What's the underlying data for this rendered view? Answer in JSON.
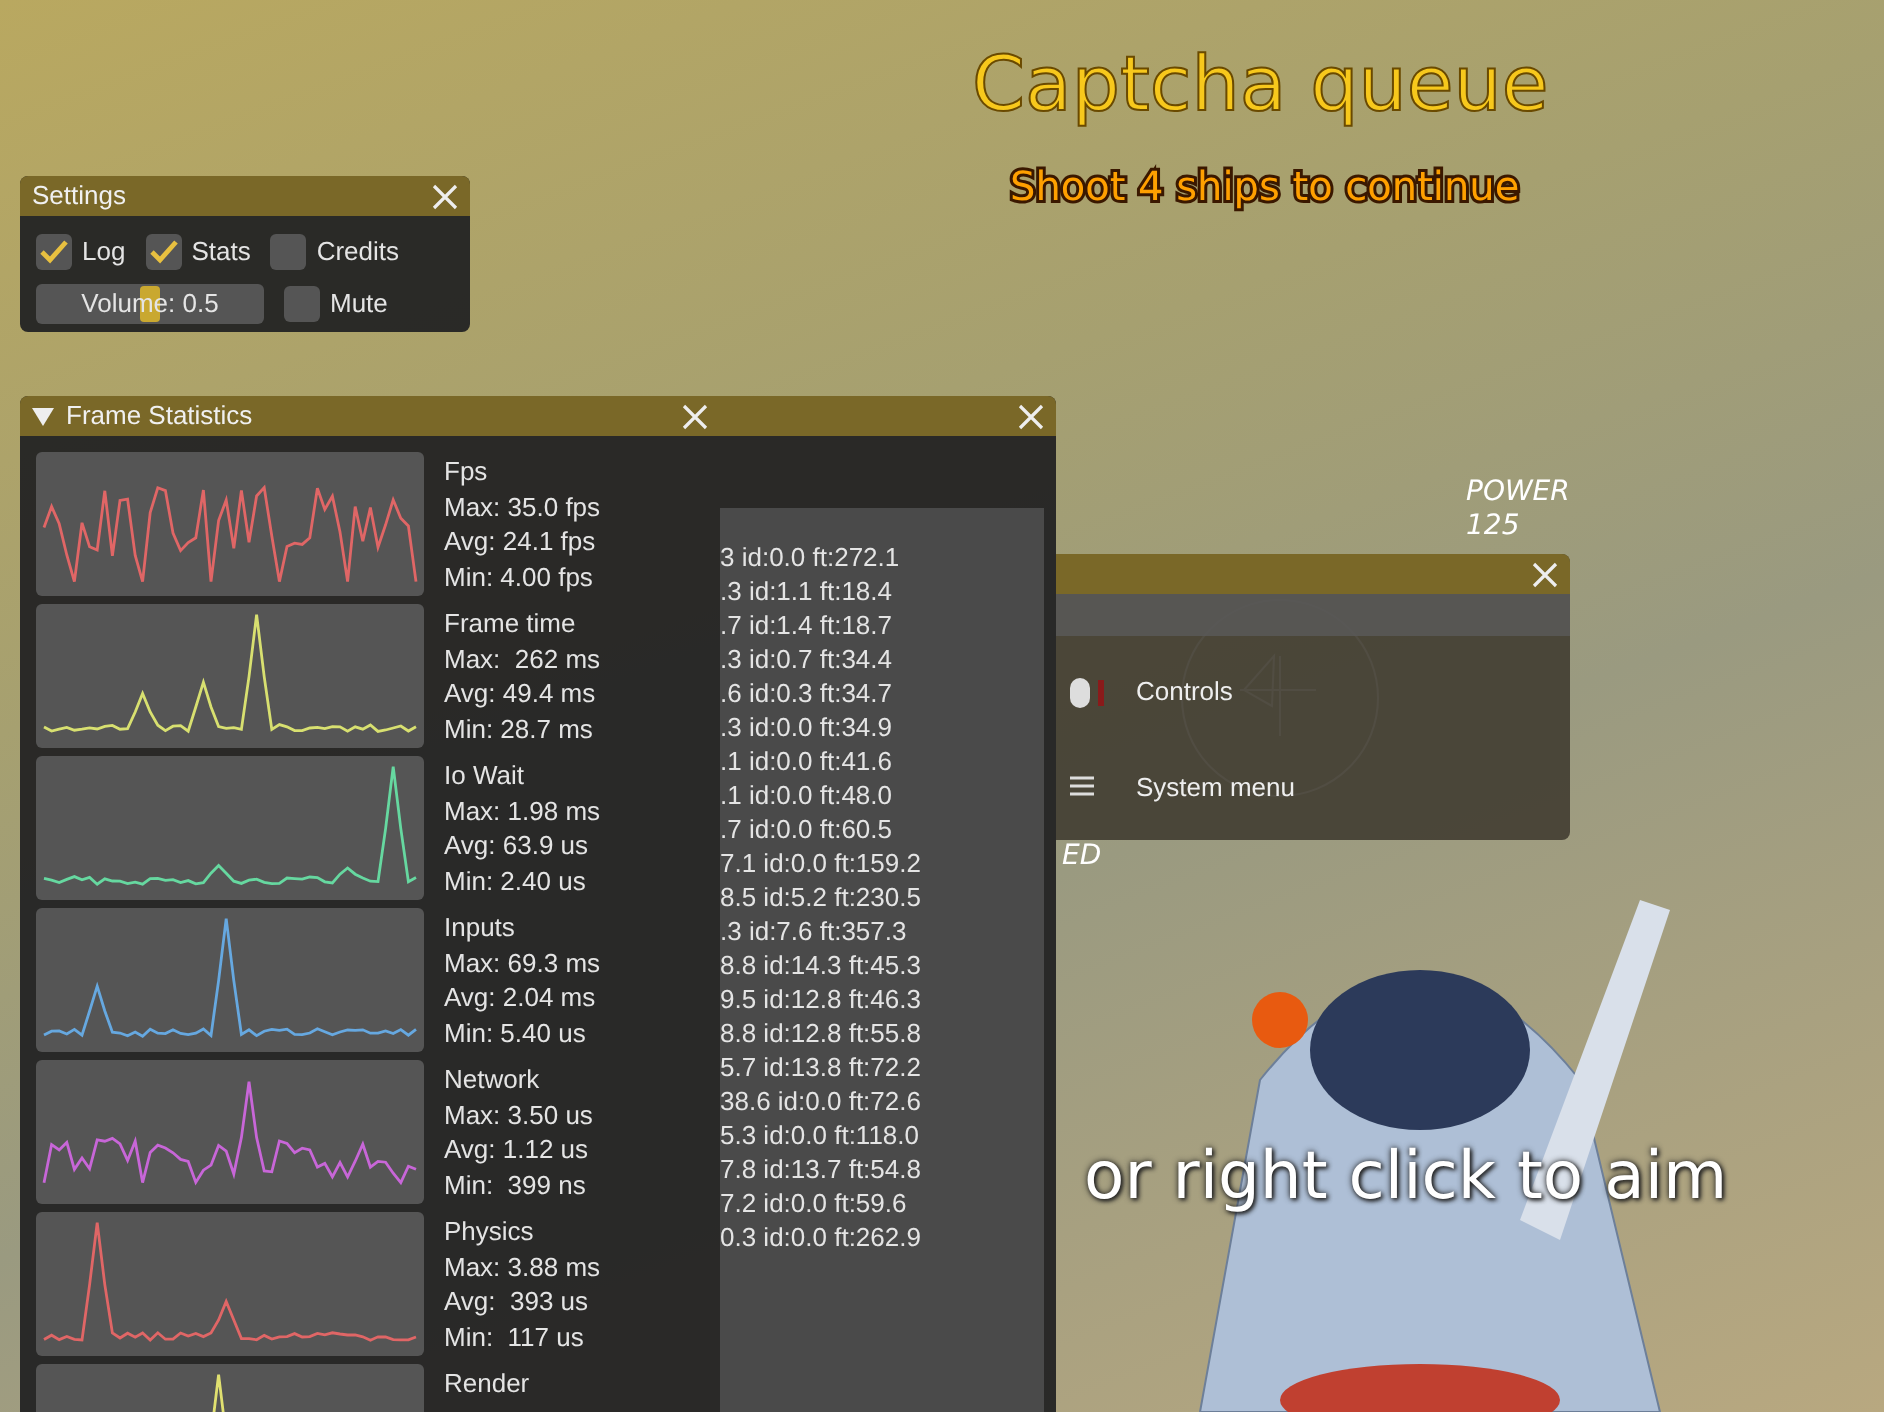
{
  "hud": {
    "title": "Captcha queue",
    "subtitle": "Shoot 4 ships to continue",
    "power_label": "POWER",
    "power_value": "125",
    "side_text": "ED",
    "hint": "or right click to aim"
  },
  "settings": {
    "title": "Settings",
    "options": [
      {
        "kind": "checkbox",
        "label": "Log",
        "checked": true
      },
      {
        "kind": "checkbox",
        "label": "Stats",
        "checked": true
      },
      {
        "kind": "checkbox",
        "label": "Credits",
        "checked": false
      },
      {
        "kind": "slider",
        "label": "Volume: 0.5",
        "level": 0.5
      },
      {
        "kind": "checkbox",
        "label": "Mute",
        "checked": false
      }
    ]
  },
  "frame_statistics": {
    "title": "Frame Statistics",
    "expanded": true,
    "graphs": [
      {
        "name": "Fps",
        "color": "#e06666",
        "lines": [
          "Max: 35.0 fps",
          "Avg: 24.1 fps",
          "Min: 4.00 fps"
        ]
      },
      {
        "name": "Frame time",
        "color": "#d8e070",
        "lines": [
          "Max:  262 ms",
          "Avg: 49.4 ms",
          "Min: 28.7 ms"
        ]
      },
      {
        "name": "Io Wait",
        "color": "#66d8a0",
        "lines": [
          "Max: 1.98 ms",
          "Avg: 63.9 us",
          "Min: 2.40 us"
        ]
      },
      {
        "name": "Inputs",
        "color": "#66a8e0",
        "lines": [
          "Max: 69.3 ms",
          "Avg: 2.04 ms",
          "Min: 5.40 us"
        ]
      },
      {
        "name": "Network",
        "color": "#c866d8",
        "lines": [
          "Max: 3.50 us",
          "Avg: 1.12 us",
          "Min:  399 ns"
        ]
      },
      {
        "name": "Physics",
        "color": "#e06666",
        "lines": [
          "Max: 3.88 ms",
          "Avg:  393 us",
          "Min:  117 us"
        ]
      },
      {
        "name": "Render",
        "color": "#e0e070"
      }
    ]
  },
  "log": {
    "lines": [
      "3 id:0.0 ft:272.1",
      ".3 id:1.1 ft:18.4",
      ".7 id:1.4 ft:18.7",
      ".3 id:0.7 ft:34.4",
      ".6 id:0.3 ft:34.7",
      ".3 id:0.0 ft:34.9",
      ".1 id:0.0 ft:41.6",
      ".1 id:0.0 ft:48.0",
      ".7 id:0.0 ft:60.5",
      "7.1 id:0.0 ft:159.2",
      "8.5 id:5.2 ft:230.5",
      ".3 id:7.6 ft:357.3",
      "8.8 id:14.3 ft:45.3",
      "9.5 id:12.8 ft:46.3",
      "8.8 id:12.8 ft:55.8",
      "5.7 id:13.8 ft:72.2",
      "38.6 id:0.0 ft:72.6",
      "5.3 id:0.0 ft:118.0",
      "7.8 id:13.7 ft:54.8",
      "7.2 id:0.0 ft:59.6",
      "0.3 id:0.0 ft:262.9"
    ]
  },
  "menu": {
    "items": [
      {
        "kind": "mouse",
        "label": "Controls"
      },
      {
        "kind": "hamburger",
        "label": "System menu"
      }
    ]
  }
}
